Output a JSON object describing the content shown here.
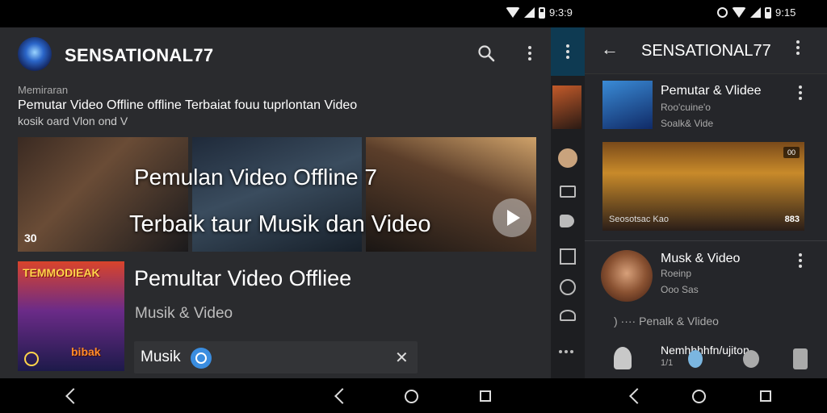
{
  "status_bar": {
    "left_time": "9:3:9",
    "right_time": "9:15"
  },
  "channel": {
    "title": "SENSATIONAL77"
  },
  "intro": {
    "label": "Memiraran",
    "title": "Pemutar Video Offline offline Terbaiat fouu tuprlontan Video",
    "subtitle": "kosik oard Vlon ond V"
  },
  "hero": {
    "line1": "Pemulan Video Offline 7",
    "line2": "Terbaik taur Musik dan Video",
    "count": "30"
  },
  "card": {
    "poster_top": "TEMMODIEAK",
    "poster_bottom": "bibak",
    "title": "Pemultar Video Offliee",
    "subtitle": "Musik & Video"
  },
  "chip": {
    "label": "Musik",
    "close": "✕"
  },
  "right_panel": {
    "title": "SENSATIONAL77",
    "item1": {
      "title": "Pemutar & Vlidee",
      "meta": "Roo'cuine'o",
      "sub": "Soalk& Vide"
    },
    "hero": {
      "caption": "Seosotsac Kao",
      "badge": "00",
      "count": "883"
    },
    "item2": {
      "title": "Musk & Video",
      "meta": "Roeinp",
      "sub": "Ooo Sas"
    },
    "line": ")  ····  Penalk & Vlideo",
    "item3": {
      "title": "Nemhhhhfn/ujiton",
      "sub": "1/1"
    }
  },
  "colors": {
    "accent": "#3a8de0",
    "panel": "#2a2b2e"
  }
}
